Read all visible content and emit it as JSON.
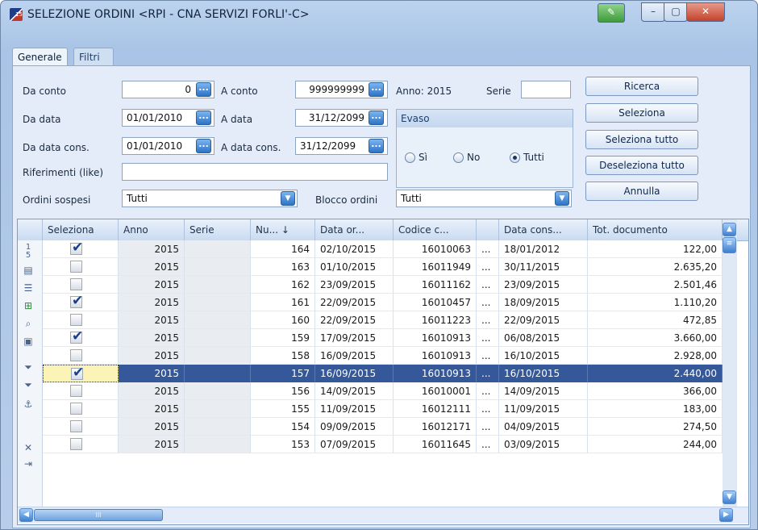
{
  "window": {
    "title": "SELEZIONE ORDINI <RPI - CNA SERVIZI FORLI'-C>",
    "app_icon_text": "15",
    "controls": [
      "min",
      "max",
      "close"
    ]
  },
  "tabs": [
    {
      "label": "Generale",
      "active": true
    },
    {
      "label": "Filtri Estesi",
      "active": false
    }
  ],
  "form": {
    "da_conto_label": "Da conto",
    "da_conto_value": "0",
    "a_conto_label": "A conto",
    "a_conto_value": "999999999",
    "anno_label": "Anno: 2015",
    "serie_label": "Serie",
    "serie_value": "",
    "da_data_label": "Da data",
    "da_data_value": "01/01/2010",
    "a_data_label": "A data",
    "a_data_value": "31/12/2099",
    "da_data_cons_label": "Da data cons.",
    "da_data_cons_value": "01/01/2010",
    "a_data_cons_label": "A data cons.",
    "a_data_cons_value": "31/12/2099",
    "riferimenti_label": "Riferimenti (like)",
    "riferimenti_value": "",
    "ordini_sospesi_label": "Ordini sospesi",
    "ordini_sospesi_value": "Tutti",
    "blocco_ordini_label": "Blocco ordini",
    "blocco_ordini_value": "Tutti",
    "dots_glyph": "...",
    "dropdown_glyph": "▼"
  },
  "evaso": {
    "title": "Evaso",
    "options": [
      {
        "label": "Sì",
        "checked": false
      },
      {
        "label": "No",
        "checked": false
      },
      {
        "label": "Tutti",
        "checked": true
      }
    ]
  },
  "buttons": {
    "ricerca": "Ricerca",
    "seleziona": "Seleziona",
    "seleziona_tutto": "Seleziona tutto",
    "deseleziona_tutto": "Deseleziona tutto",
    "annulla": "Annulla"
  },
  "grid": {
    "columns": [
      "Seleziona",
      "Anno",
      "Serie",
      "Nu... ↓",
      "Data or...",
      "Codice c...",
      "",
      "Data cons...",
      "Tot. documento"
    ],
    "row_counter": "1\n5",
    "rows": [
      {
        "selected": true,
        "anno": "2015",
        "serie": "",
        "numero": "164",
        "data_ordine": "02/10/2015",
        "codice": "16010063",
        "more": "...",
        "data_cons": "18/01/2012",
        "totale": "122,00",
        "highlight": false
      },
      {
        "selected": false,
        "anno": "2015",
        "serie": "",
        "numero": "163",
        "data_ordine": "01/10/2015",
        "codice": "16011949",
        "more": "...",
        "data_cons": "30/11/2015",
        "totale": "2.635,20",
        "highlight": false
      },
      {
        "selected": false,
        "anno": "2015",
        "serie": "",
        "numero": "162",
        "data_ordine": "23/09/2015",
        "codice": "16011162",
        "more": "...",
        "data_cons": "23/09/2015",
        "totale": "2.501,46",
        "highlight": false
      },
      {
        "selected": true,
        "anno": "2015",
        "serie": "",
        "numero": "161",
        "data_ordine": "22/09/2015",
        "codice": "16010457",
        "more": "...",
        "data_cons": "18/09/2015",
        "totale": "1.110,20",
        "highlight": false
      },
      {
        "selected": false,
        "anno": "2015",
        "serie": "",
        "numero": "160",
        "data_ordine": "22/09/2015",
        "codice": "16011223",
        "more": "...",
        "data_cons": "22/09/2015",
        "totale": "472,85",
        "highlight": false
      },
      {
        "selected": true,
        "anno": "2015",
        "serie": "",
        "numero": "159",
        "data_ordine": "17/09/2015",
        "codice": "16010913",
        "more": "...",
        "data_cons": "06/08/2015",
        "totale": "3.660,00",
        "highlight": false
      },
      {
        "selected": false,
        "anno": "2015",
        "serie": "",
        "numero": "158",
        "data_ordine": "16/09/2015",
        "codice": "16010913",
        "more": "...",
        "data_cons": "16/10/2015",
        "totale": "2.928,00",
        "highlight": false
      },
      {
        "selected": true,
        "anno": "2015",
        "serie": "",
        "numero": "157",
        "data_ordine": "16/09/2015",
        "codice": "16010913",
        "more": "...",
        "data_cons": "16/10/2015",
        "totale": "2.440,00",
        "highlight": true
      },
      {
        "selected": false,
        "anno": "2015",
        "serie": "",
        "numero": "156",
        "data_ordine": "14/09/2015",
        "codice": "16010001",
        "more": "...",
        "data_cons": "14/09/2015",
        "totale": "366,00",
        "highlight": false
      },
      {
        "selected": false,
        "anno": "2015",
        "serie": "",
        "numero": "155",
        "data_ordine": "11/09/2015",
        "codice": "16012111",
        "more": "...",
        "data_cons": "11/09/2015",
        "totale": "183,00",
        "highlight": false
      },
      {
        "selected": false,
        "anno": "2015",
        "serie": "",
        "numero": "154",
        "data_ordine": "09/09/2015",
        "codice": "16012171",
        "more": "...",
        "data_cons": "04/09/2015",
        "totale": "274,50",
        "highlight": false
      },
      {
        "selected": false,
        "anno": "2015",
        "serie": "",
        "numero": "153",
        "data_ordine": "07/09/2015",
        "codice": "16011645",
        "more": "...",
        "data_cons": "03/09/2015",
        "totale": "244,00",
        "highlight": false
      }
    ],
    "hscroll_thumb": "III"
  },
  "colors": {
    "selected_row": "#34589a",
    "focus_cell": "#fbf4b6",
    "accent": "#2e74c6"
  }
}
